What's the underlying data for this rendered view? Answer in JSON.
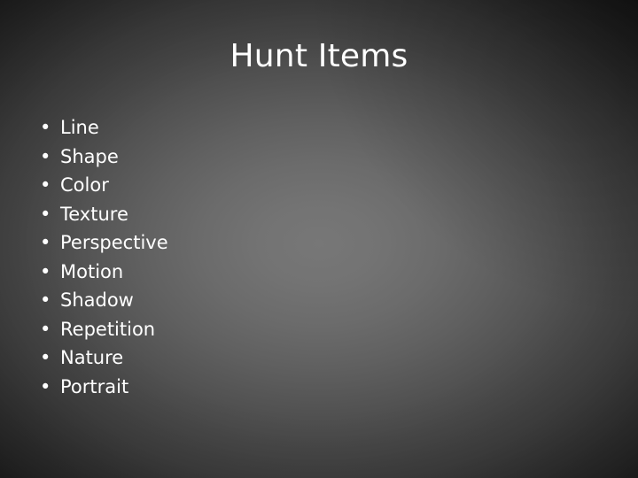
{
  "slide": {
    "title": "Hunt Items",
    "bullet_glyph": "•",
    "text_color": "#ffffff",
    "background": {
      "center_color": "#757575",
      "edge_color": "#1c1c1c"
    },
    "items": [
      {
        "label": "Line"
      },
      {
        "label": "Shape"
      },
      {
        "label": "Color"
      },
      {
        "label": "Texture"
      },
      {
        "label": "Perspective"
      },
      {
        "label": "Motion"
      },
      {
        "label": "Shadow"
      },
      {
        "label": "Repetition"
      },
      {
        "label": "Nature"
      },
      {
        "label": "Portrait"
      }
    ]
  }
}
